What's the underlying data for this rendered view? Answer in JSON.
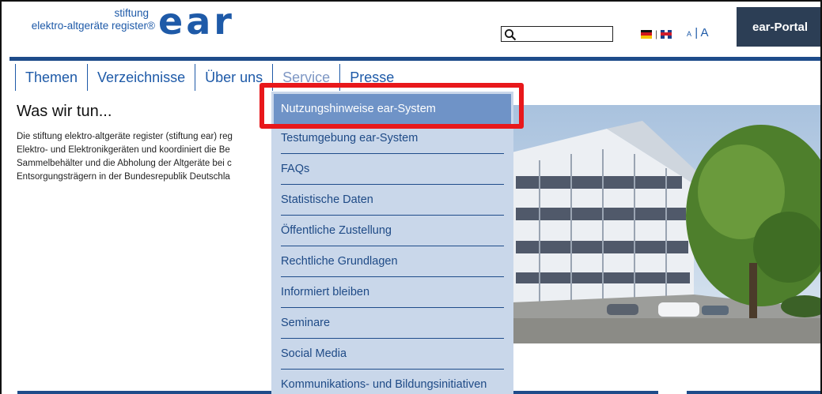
{
  "header": {
    "logo_line1": "stiftung",
    "logo_line2": "elektro-altgeräte register®",
    "logo_mark": "ear",
    "search": {
      "value": "",
      "placeholder": ""
    },
    "lang_separator": "|",
    "font_size_small": "A",
    "font_size_sep": "|",
    "font_size_large": "A",
    "portal_label": "ear-Portal"
  },
  "nav": {
    "items": [
      {
        "label": "Themen"
      },
      {
        "label": "Verzeichnisse"
      },
      {
        "label": "Über uns"
      },
      {
        "label": "Service"
      },
      {
        "label": "Presse"
      }
    ]
  },
  "content": {
    "title": "Was wir tun...",
    "paragraph_lines": [
      "Die stiftung elektro-altgeräte register (stiftung ear) reg",
      "Elektro- und Elektronikgeräten und koordiniert die Be",
      "Sammelbehälter und die Abholung der Altgeräte bei c",
      "Entsorgungsträgern in der Bundesrepublik Deutschla"
    ]
  },
  "dropdown": {
    "items": [
      {
        "label": "Nutzungshinweise ear-System"
      },
      {
        "label": "Testumgebung ear-System"
      },
      {
        "label": "FAQs"
      },
      {
        "label": "Statistische Daten"
      },
      {
        "label": "Öffentliche Zustellung"
      },
      {
        "label": "Rechtliche Grundlagen"
      },
      {
        "label": "Informiert bleiben"
      },
      {
        "label": "Seminare"
      },
      {
        "label": "Social Media"
      },
      {
        "label": "Kommunikations- und Bildungsinitiativen"
      }
    ]
  },
  "colors": {
    "brand_blue": "#1e5aa8",
    "rule_blue": "#1e4c8a",
    "dropdown_bg": "#c9d7ea",
    "dropdown_active": "#6f93c7",
    "portal_bg": "#2c3e55",
    "highlight_red": "#e8181b"
  },
  "icons": {
    "search": "search-icon",
    "german_flag": "german-flag-icon",
    "uk_flag": "uk-flag-icon"
  }
}
